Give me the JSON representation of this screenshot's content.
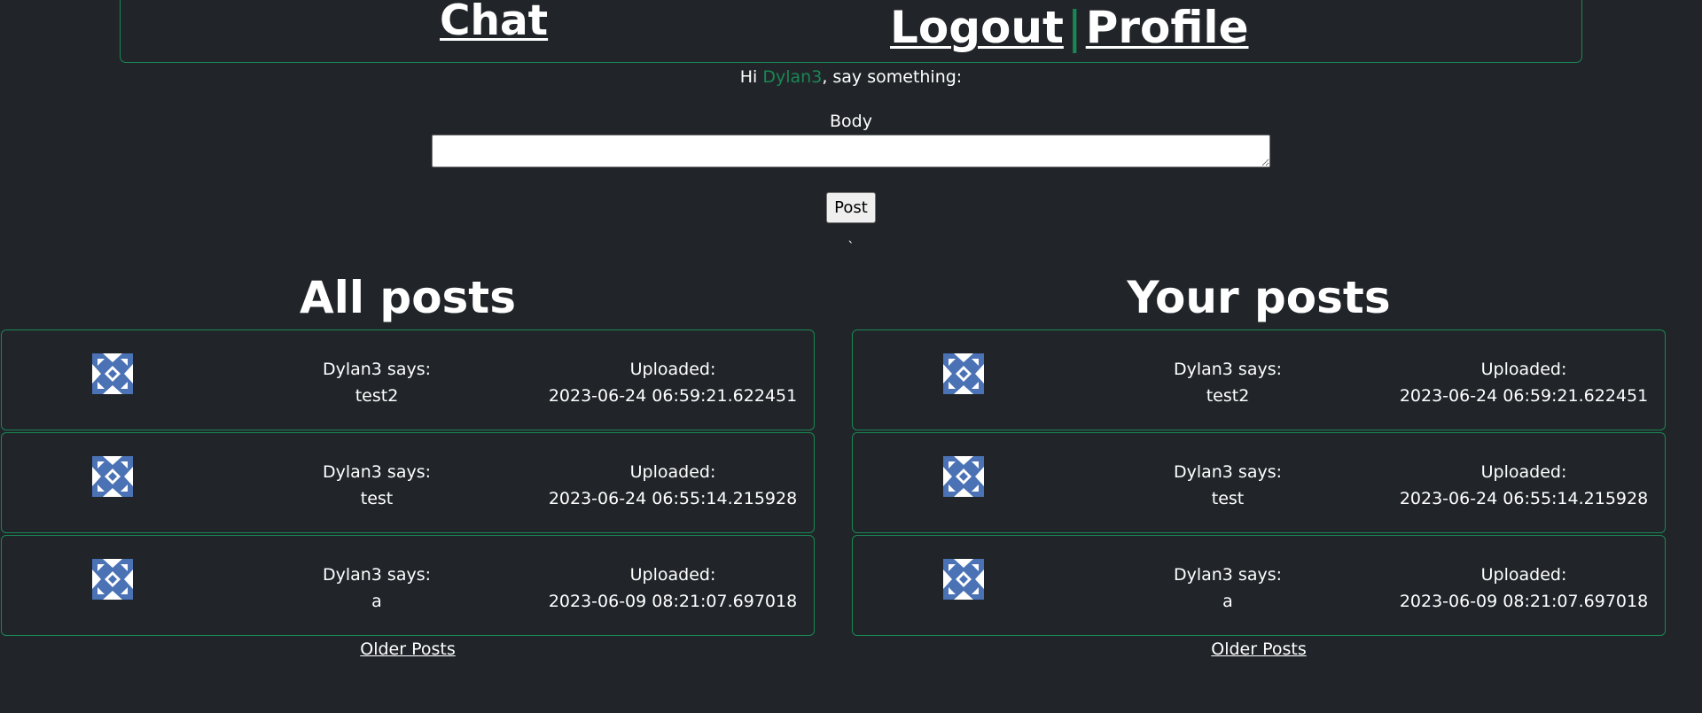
{
  "nav": {
    "chat": "Chat",
    "logout": "Logout",
    "separator": "|",
    "profile": "Profile"
  },
  "greeting": {
    "prefix": "Hi ",
    "username": "Dylan3",
    "suffix": ", say something:"
  },
  "form": {
    "body_label": "Body",
    "body_value": "",
    "post_label": "Post",
    "stray_char": "`"
  },
  "all_posts": {
    "title": "All posts",
    "posts": [
      {
        "author_line": "Dylan3 says:",
        "body": "test2",
        "uploaded_label": "Uploaded:",
        "uploaded": "2023-06-24 06:59:21.622451"
      },
      {
        "author_line": "Dylan3 says:",
        "body": "test",
        "uploaded_label": "Uploaded:",
        "uploaded": "2023-06-24 06:55:14.215928"
      },
      {
        "author_line": "Dylan3 says:",
        "body": "a",
        "uploaded_label": "Uploaded:",
        "uploaded": "2023-06-09 08:21:07.697018"
      }
    ],
    "older": "Older Posts"
  },
  "your_posts": {
    "title": "Your posts",
    "posts": [
      {
        "author_line": "Dylan3 says:",
        "body": "test2",
        "uploaded_label": "Uploaded:",
        "uploaded": "2023-06-24 06:59:21.622451"
      },
      {
        "author_line": "Dylan3 says:",
        "body": "test",
        "uploaded_label": "Uploaded:",
        "uploaded": "2023-06-24 06:55:14.215928"
      },
      {
        "author_line": "Dylan3 says:",
        "body": "a",
        "uploaded_label": "Uploaded:",
        "uploaded": "2023-06-09 08:21:07.697018"
      }
    ],
    "older": "Older Posts"
  },
  "colors": {
    "background": "#212529",
    "accent": "#198754",
    "text": "#ffffff",
    "avatar_pattern": "#4a72b5"
  },
  "icons": {
    "avatar": "identicon-avatar-icon"
  }
}
